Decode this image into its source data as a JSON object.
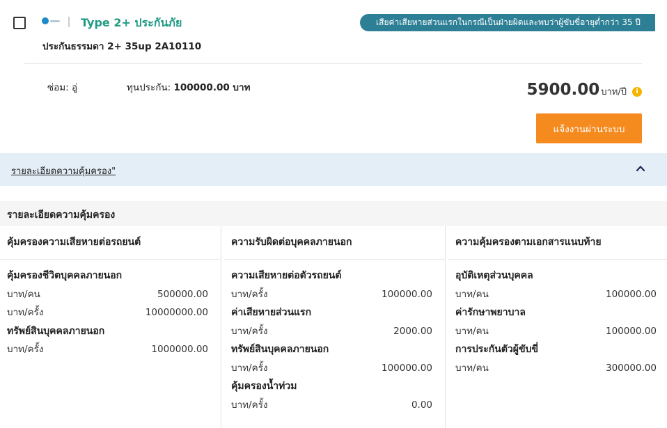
{
  "header": {
    "title": "Type 2+ ประกันภัย",
    "subtitle": "ประกันธรรมดา 2+ 35up 2A10110",
    "warning": "เสียค่าเสียหายส่วนแรกในกรณีเป็นฝ่ายผิดและพบว่าผู้ขับขี่อายุต่ำกว่า 35 ปี",
    "brand_color": "#1f9a84",
    "badge_color": "#2d7f95"
  },
  "info": {
    "repair_label": "ซ่อม:",
    "repair_value": "อู่",
    "sum_label": "ทุนประกัน:",
    "sum_value": "100000.00 บาท"
  },
  "price": {
    "amount": "5900.00",
    "unit": "บาท/ปี",
    "info_icon": "i"
  },
  "actions": {
    "report_label": "แจ้งงานผ่านระบบ",
    "coverage_toggle": "รายละเอียดความคุ้มครอง\""
  },
  "details": {
    "title": "รายละเอียดความคุ้มครอง",
    "columns": [
      {
        "header": "คุ้มครองความเสียหายต่อรถยนต์",
        "groups": [
          {
            "name": "คุ้มครองชีวิตบุคคลภายนอก",
            "rows": [
              {
                "unit": "บาท/คน",
                "value": "500000.00"
              },
              {
                "unit": "บาท/ครั้ง",
                "value": "10000000.00"
              }
            ]
          },
          {
            "name": "ทรัพย์สินบุคคลภายนอก",
            "rows": [
              {
                "unit": "บาท/ครั้ง",
                "value": "1000000.00"
              }
            ]
          }
        ]
      },
      {
        "header": "ความรับผิดต่อบุคคลภายนอก",
        "groups": [
          {
            "name": "ความเสียหายต่อตัวรถยนต์",
            "rows": [
              {
                "unit": "บาท/ครั้ง",
                "value": "100000.00"
              }
            ]
          },
          {
            "name": "ค่าเสียหายส่วนแรก",
            "rows": [
              {
                "unit": "บาท/ครั้ง",
                "value": "2000.00"
              }
            ]
          },
          {
            "name": "ทรัพย์สินบุคคลภายนอก",
            "rows": [
              {
                "unit": "บาท/ครั้ง",
                "value": "100000.00"
              }
            ]
          },
          {
            "name": "คุ้มครองน้ำท่วม",
            "rows": [
              {
                "unit": "บาท/ครั้ง",
                "value": "0.00"
              }
            ]
          }
        ]
      },
      {
        "header": "ความคุ้มครองตามเอกสารแนบท้าย",
        "groups": [
          {
            "name": "อุบัติเหตุส่วนบุคคล",
            "rows": [
              {
                "unit": "บาท/คน",
                "value": "100000.00"
              }
            ]
          },
          {
            "name": "ค่ารักษาพยาบาล",
            "rows": [
              {
                "unit": "บาท/คน",
                "value": "100000.00"
              }
            ]
          },
          {
            "name": "การประกันตัวผู้ขับขี่",
            "rows": [
              {
                "unit": "บาท/คน",
                "value": "300000.00"
              }
            ]
          }
        ]
      }
    ]
  }
}
